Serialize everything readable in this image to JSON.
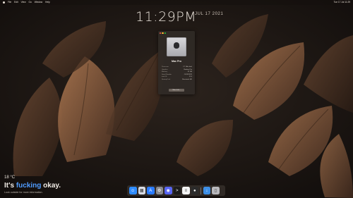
{
  "menubar": {
    "left_items": [
      "File",
      "Edit",
      "View",
      "Go",
      "Window",
      "Help"
    ],
    "right_items": [
      "Tue 17 Jul 11:29"
    ]
  },
  "clock": {
    "time": "11:29PM",
    "date": "JUL 17 2021"
  },
  "about_window": {
    "model": "Mac Pro",
    "specs": [
      {
        "key": "Processor",
        "value": "2.7 GHz Intel"
      },
      {
        "key": "Graphics",
        "value": "Radeon Pro"
      },
      {
        "key": "Memory",
        "value": "32 GB"
      },
      {
        "key": "Serial Number",
        "value": "C02XXXXX"
      },
      {
        "key": "macOS",
        "value": "11.4"
      },
      {
        "key": "Startup Disk",
        "value": "Macintosh HD"
      }
    ],
    "button_label": "More Info..."
  },
  "widget": {
    "temperature": "18 °C",
    "tagline_prefix": "It's ",
    "tagline_highlight": "fucking",
    "tagline_suffix": " okay.",
    "subtext": "Look outside for more information."
  },
  "dock": {
    "apps": [
      {
        "icon": "finder-icon",
        "color": "#2f8cff",
        "glyph": "☺"
      },
      {
        "icon": "launchpad-icon",
        "color": "#d8dbe4",
        "glyph": "▦"
      },
      {
        "icon": "app-store-icon",
        "color": "#2a7bff",
        "glyph": "A"
      },
      {
        "icon": "settings-icon",
        "color": "#8a8a8e",
        "glyph": "⚙"
      },
      {
        "icon": "discord-icon",
        "color": "#5865f2",
        "glyph": "◉"
      },
      {
        "icon": "terminal-icon",
        "color": "#1b1b1b",
        "glyph": ">"
      },
      {
        "icon": "notes-icon",
        "color": "#f4f4f4",
        "glyph": "≡"
      },
      {
        "icon": "github-icon",
        "color": "#2b2b2b",
        "glyph": "●"
      }
    ],
    "folders": [
      {
        "icon": "downloads-folder-icon",
        "color": "#3d8fe6",
        "glyph": "↓"
      },
      {
        "icon": "trash-icon",
        "color": "#b9b9bd",
        "glyph": "▯"
      }
    ]
  }
}
